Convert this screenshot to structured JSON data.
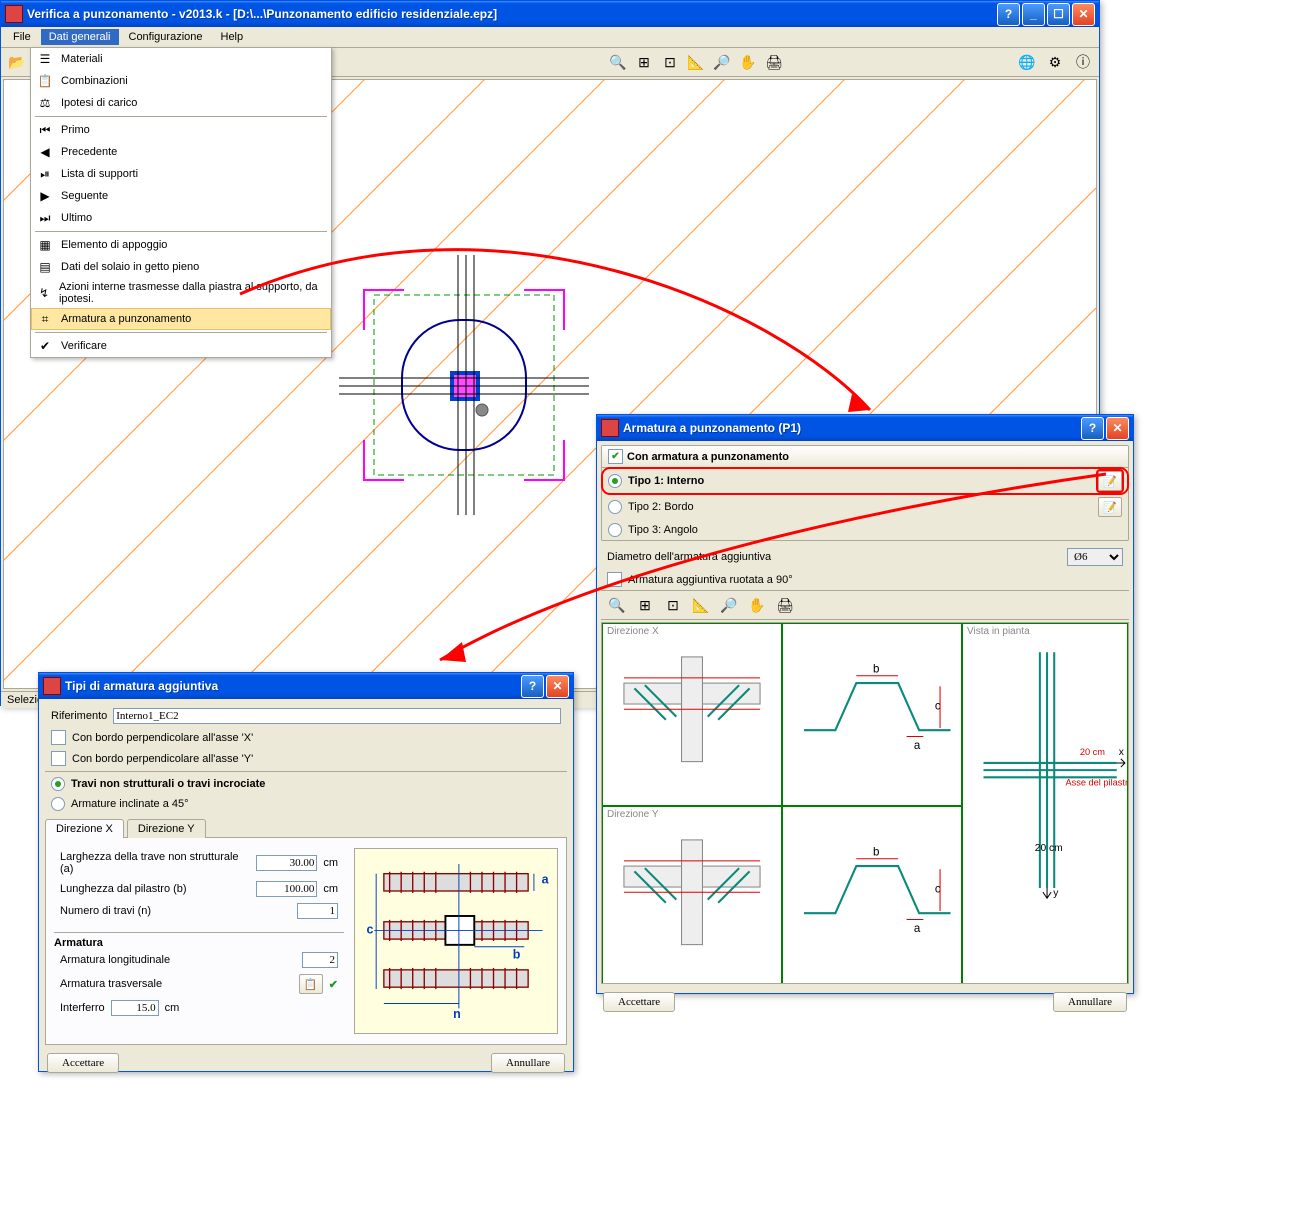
{
  "mainWindow": {
    "title": "Verifica a punzonamento - v2013.k - [D:\\...\\Punzonamento edificio residenziale.epz]",
    "menus": {
      "file": "File",
      "dati": "Dati generali",
      "config": "Configurazione",
      "help": "Help"
    },
    "dropdown": {
      "materiali": "Materiali",
      "combinazioni": "Combinazioni",
      "ipotesi": "Ipotesi di carico",
      "primo": "Primo",
      "precedente": "Precedente",
      "lista": "Lista di supporti",
      "seguente": "Seguente",
      "ultimo": "Ultimo",
      "elemento": "Elemento di appoggio",
      "datisolaio": "Dati del solaio in getto pieno",
      "azioni": "Azioni interne trasmesse dalla piastra al supporto, da ipotesi.",
      "armatura": "Armatura a punzonamento",
      "verificare": "Verificare"
    },
    "status": "Selezion"
  },
  "armDialog": {
    "title": "Armatura a punzonamento (P1)",
    "chk_con": "Con armatura a punzonamento",
    "opt_tipo1": "Tipo 1: Interno",
    "opt_tipo2": "Tipo 2: Bordo",
    "opt_tipo3": "Tipo 3: Angolo",
    "lbl_diam": "Diametro dell'armatura aggiuntiva",
    "sel_diam": "Ø6",
    "chk_rot": "Armatura aggiuntiva ruotata a 90°",
    "pv_dirx": "Direzione X",
    "pv_diry": "Direzione Y",
    "pv_pianta": "Vista in pianta",
    "pv_asse": "Asse del pilastro",
    "pv_20cm_a": "20 cm",
    "pv_20cm_b": "20 cm",
    "btn_accept": "Accettare",
    "btn_cancel": "Annullare"
  },
  "tipiDialog": {
    "title": "Tipi di armatura aggiuntiva",
    "lbl_rif": "Riferimento",
    "val_rif": "Interno1_EC2",
    "chk_bx": "Con bordo perpendicolare all'asse 'X'",
    "chk_by": "Con bordo perpendicolare all'asse 'Y'",
    "opt_travi": "Travi non strutturali o travi incrociate",
    "opt_arm45": "Armature inclinate a 45°",
    "tab_dx": "Direzione X",
    "tab_dy": "Direzione Y",
    "lbl_larg": "Larghezza della trave non strutturale (a)",
    "val_larg": "30.00",
    "u_larg": "cm",
    "lbl_lung": "Lunghezza dal pilastro (b)",
    "val_lung": "100.00",
    "u_lung": "cm",
    "lbl_num": "Numero di travi (n)",
    "val_num": "1",
    "hdr_arm": "Armatura",
    "lbl_along": "Armatura longitudinale",
    "val_along": "2",
    "lbl_atras": "Armatura trasversale",
    "lbl_inter": "Interferro",
    "val_inter": "15.0",
    "u_inter": "cm",
    "btn_accept": "Accettare",
    "btn_cancel": "Annullare"
  }
}
